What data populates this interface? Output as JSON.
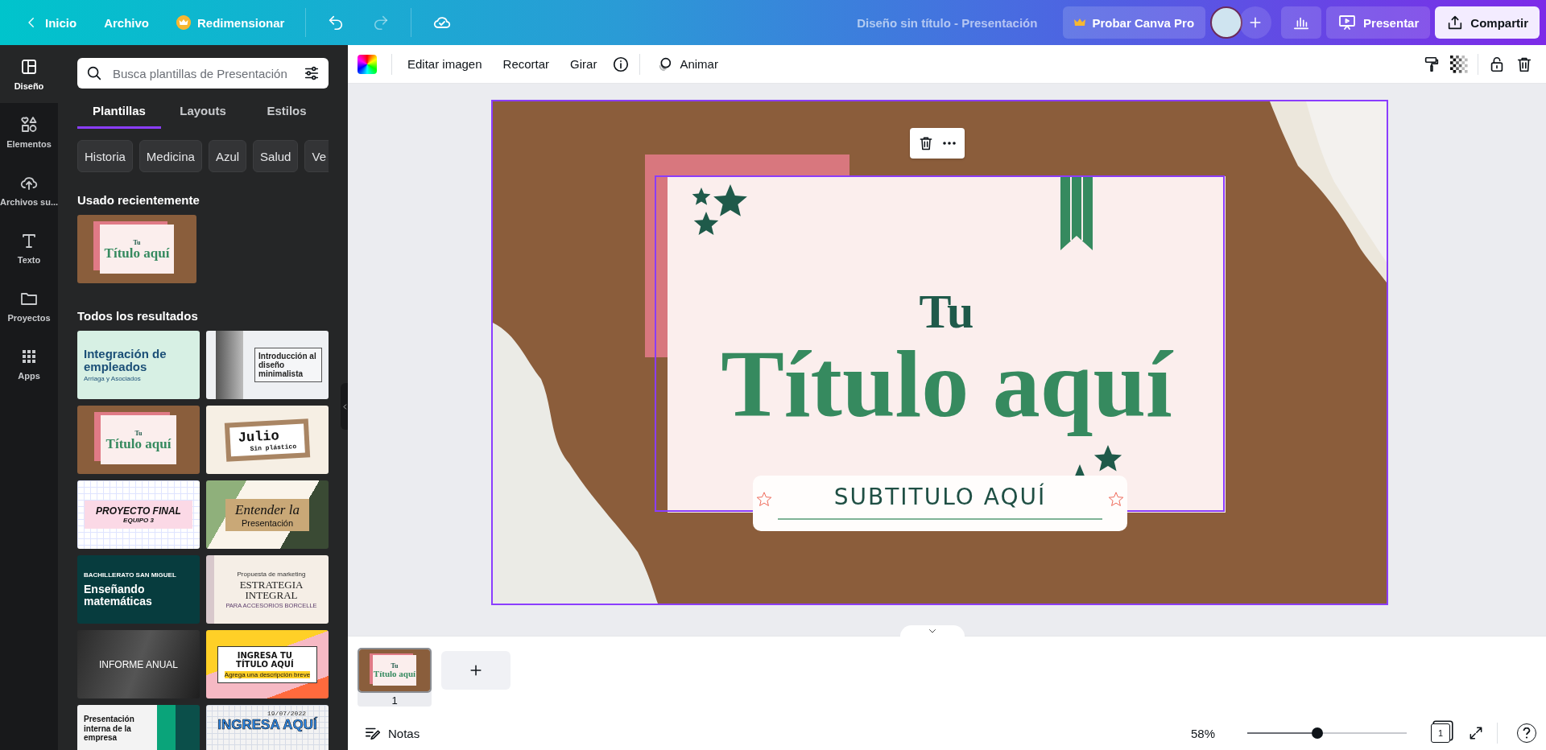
{
  "top_bar": {
    "home": "Inicio",
    "file": "Archivo",
    "resize": "Redimensionar",
    "undo": {
      "disabled": false
    },
    "redo": {
      "disabled": true
    },
    "document_title": "Diseño sin título - Presentación",
    "pro_button": "Probar Canva Pro",
    "present_button": "Presentar",
    "share_button": "Compartir"
  },
  "side_rail": [
    {
      "label": "Diseño",
      "selected": true
    },
    {
      "label": "Elementos",
      "selected": false
    },
    {
      "label": "Archivos su...",
      "selected": false
    },
    {
      "label": "Texto",
      "selected": false
    },
    {
      "label": "Proyectos",
      "selected": false
    },
    {
      "label": "Apps",
      "selected": false
    }
  ],
  "panel": {
    "search": {
      "placeholder": "Busca plantillas de Presentación"
    },
    "tabs": [
      {
        "label": "Plantillas",
        "selected": true
      },
      {
        "label": "Layouts",
        "selected": false
      },
      {
        "label": "Estilos",
        "selected": false
      }
    ],
    "chips": [
      "Historia",
      "Medicina",
      "Azul",
      "Salud",
      "Ve"
    ],
    "recent_heading": "Usado recientemente",
    "recent": [
      {
        "kind": "kraft",
        "lines": [
          "Tu",
          "Título aquí"
        ]
      }
    ],
    "all_heading": "Todos los resultados",
    "templates": [
      {
        "kind": "mint",
        "lines": [
          "Integración de empleados",
          "Arriaga y Asociados"
        ]
      },
      {
        "kind": "minimal",
        "lines": [
          "Introducción al diseño minimalista"
        ]
      },
      {
        "kind": "kraft",
        "lines": [
          "Tu",
          "Título aquí"
        ]
      },
      {
        "kind": "collage",
        "lines": [
          "Julio",
          "Sin plástico"
        ]
      },
      {
        "kind": "grid",
        "lines": [
          "PROYECTO FINAL",
          "EQUIPO 3"
        ]
      },
      {
        "kind": "brush",
        "lines": [
          "Entender la",
          "Presentación"
        ]
      },
      {
        "kind": "teal",
        "lines": [
          "BACHILLERATO SAN MIGUEL",
          "Enseñando matemáticas"
        ]
      },
      {
        "kind": "elegant",
        "lines": [
          "Propuesta de marketing",
          "ESTRATEGIA INTEGRAL",
          "PARA ACCESORIOS BORCELLE"
        ]
      },
      {
        "kind": "dark",
        "lines": [
          "INFORME ANUAL"
        ]
      },
      {
        "kind": "notebook",
        "lines": [
          "INGRESA TU TÍTULO AQUÍ",
          "Agrega una descripción breve"
        ]
      },
      {
        "kind": "hexagon",
        "lines": [
          "Presentación interna de la empresa"
        ]
      },
      {
        "kind": "scrapbook",
        "lines": [
          "19/07/2022",
          "INGRESA AQUÍ"
        ]
      }
    ]
  },
  "toolbar": {
    "items": [
      "Editar imagen",
      "Recortar",
      "Girar"
    ],
    "animate": "Animar"
  },
  "slide": {
    "kicker": "Tu",
    "title": "Título aquí",
    "subtitle": "SUBTITULO AQUÍ"
  },
  "pages": [
    {
      "number": "1",
      "selected": true,
      "kicker": "Tu",
      "title": "Título aquí"
    }
  ],
  "bottom_bar": {
    "notes": "Notas",
    "zoom": {
      "reading": "58%",
      "level": 0.44
    },
    "page_count": "1"
  }
}
